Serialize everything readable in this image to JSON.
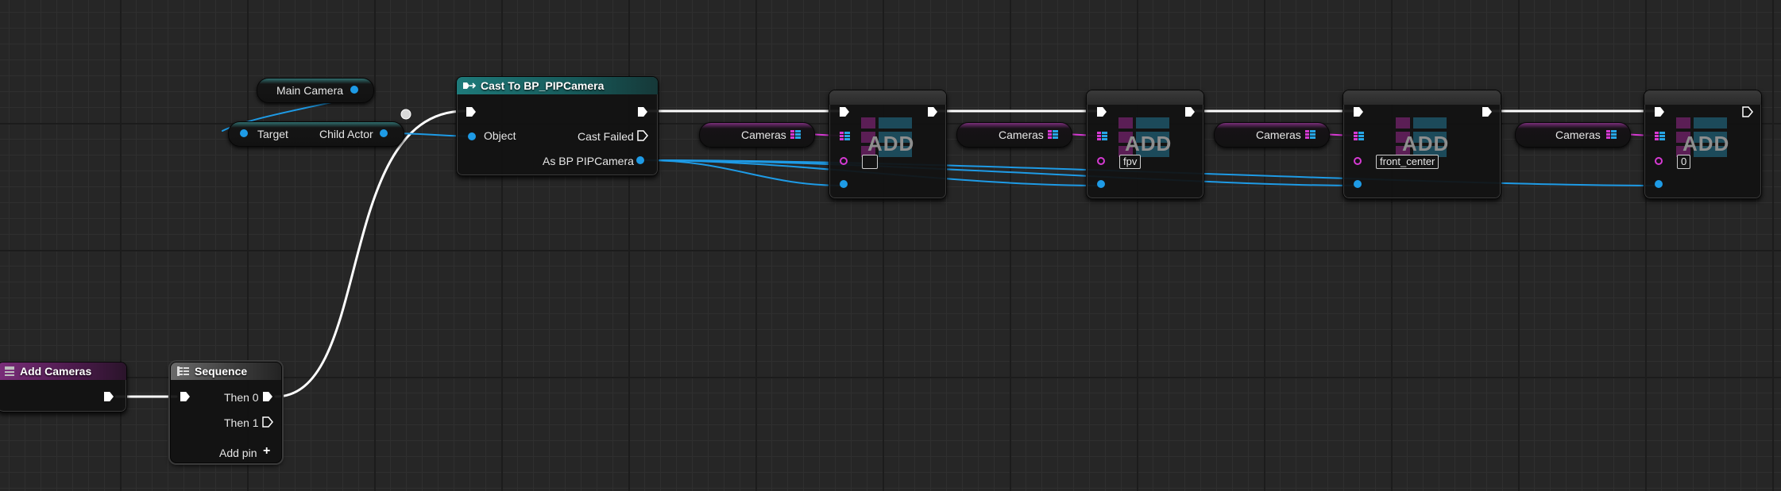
{
  "event": {
    "title": "Add Cameras"
  },
  "sequence": {
    "title": "Sequence",
    "then0": "Then 0",
    "then1": "Then 1",
    "add_pin": "Add pin"
  },
  "vars": {
    "main_camera": "Main Camera",
    "target": "Target",
    "child_actor": "Child Actor"
  },
  "cast": {
    "title": "Cast To BP_PIPCamera",
    "object": "Object",
    "cast_failed": "Cast Failed",
    "as_pip": "As BP PIPCamera"
  },
  "cameras_label": "Cameras",
  "add_label": "ADD",
  "add_nodes": [
    {
      "input": ""
    },
    {
      "input": "fpv"
    },
    {
      "input": "front_center"
    },
    {
      "input": "0"
    }
  ],
  "colors": {
    "exec": "#ffffff",
    "object_pin": "#1e9be6",
    "name_pin": "#d63ad3",
    "wire_object": "#1e9be6",
    "wire_array": "#d63ad3"
  },
  "icons": [
    "event-icon",
    "sequence-icon",
    "cast-icon",
    "array-icon",
    "exec-pin-icon",
    "plus-icon"
  ]
}
